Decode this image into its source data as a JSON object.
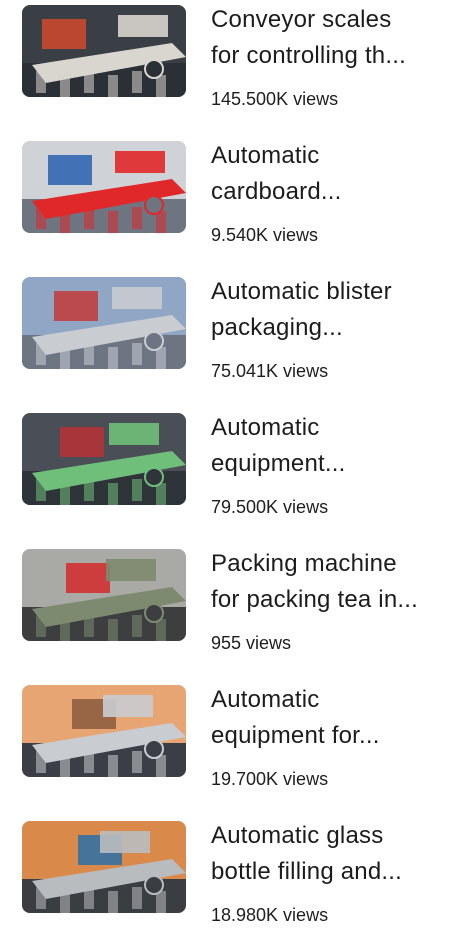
{
  "videos": [
    {
      "title_line1": "Conveyor scales",
      "title_line2": "for controlling th...",
      "views": "145.500K views",
      "thumb_icon": "conveyor-scales-thumbnail",
      "colors": {
        "bg": "#3a3f46",
        "main": "#d9d5cf",
        "accent": "#d24a2a",
        "dark": "#2b2f36"
      }
    },
    {
      "title_line1": "Automatic",
      "title_line2": "cardboard...",
      "views": "9.540K views",
      "thumb_icon": "cardboard-machine-thumbnail",
      "colors": {
        "bg": "#cfd3d8",
        "main": "#e0282a",
        "accent": "#2a5fb0",
        "dark": "#6e7480"
      }
    },
    {
      "title_line1": "Automatic blister",
      "title_line2": "packaging...",
      "views": "75.041K views",
      "thumb_icon": "blister-packaging-thumbnail",
      "colors": {
        "bg": "#8fa6c4",
        "main": "#c9ccd1",
        "accent": "#c23a3a",
        "dark": "#6d7583"
      }
    },
    {
      "title_line1": "Automatic",
      "title_line2": "equipment...",
      "views": "79.500K views",
      "thumb_icon": "packaging-equipment-thumbnail",
      "colors": {
        "bg": "#4a4f57",
        "main": "#6fbf7a",
        "accent": "#b83035",
        "dark": "#2f343b"
      }
    },
    {
      "title_line1": "Packing machine",
      "title_line2": "for packing tea in...",
      "views": "955 views",
      "thumb_icon": "tea-packing-machine-thumbnail",
      "colors": {
        "bg": "#a9aaa6",
        "main": "#7e8a6f",
        "accent": "#d42a2a",
        "dark": "#3c3e40"
      }
    },
    {
      "title_line1": "Automatic",
      "title_line2": "equipment for...",
      "views": "19.700K views",
      "thumb_icon": "filling-equipment-thumbnail",
      "colors": {
        "bg": "#e8a574",
        "main": "#c9ccd0",
        "accent": "#8a5a3c",
        "dark": "#3b3f45"
      }
    },
    {
      "title_line1": "Automatic glass",
      "title_line2": "bottle filling and...",
      "views": "18.980K views",
      "thumb_icon": "bottle-filling-thumbnail",
      "colors": {
        "bg": "#d98a4a",
        "main": "#b9bcbf",
        "accent": "#2c6fa8",
        "dark": "#3a3d42"
      }
    }
  ]
}
